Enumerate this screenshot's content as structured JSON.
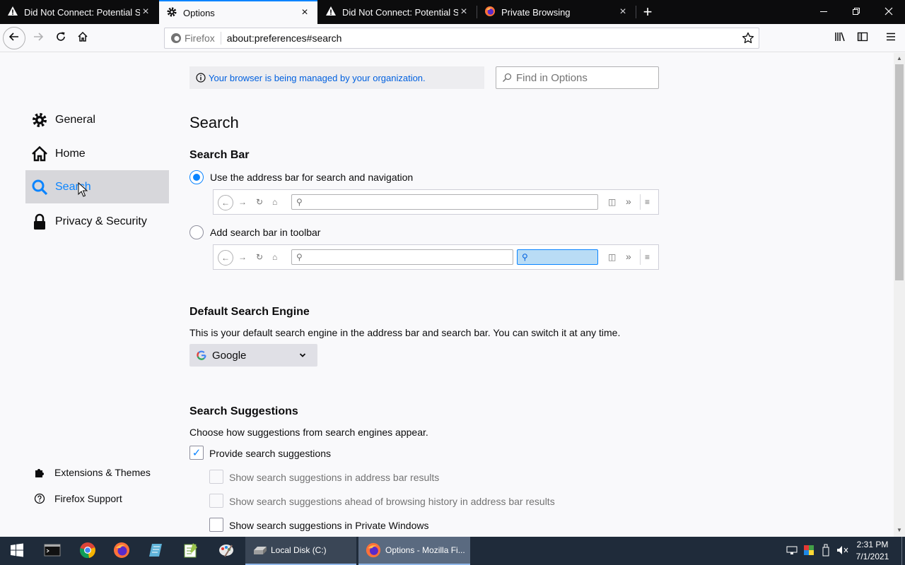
{
  "tabs": [
    {
      "label": "Did Not Connect: Potential Sec",
      "icon": "warning-icon"
    },
    {
      "label": "Options",
      "icon": "gear-icon"
    },
    {
      "label": "Did Not Connect: Potential Sec",
      "icon": "warning-icon"
    },
    {
      "label": "Private Browsing",
      "icon": "firefox-icon"
    }
  ],
  "urlbar": {
    "identity": "Firefox",
    "url": "about:preferences#search"
  },
  "managed_notice": "Your browser is being managed by your organization.",
  "find_placeholder": "Find in Options",
  "sidebar": {
    "items": [
      {
        "label": "General",
        "icon": "gear-icon"
      },
      {
        "label": "Home",
        "icon": "home-icon"
      },
      {
        "label": "Search",
        "icon": "search-icon"
      },
      {
        "label": "Privacy & Security",
        "icon": "lock-icon"
      }
    ],
    "footer": [
      {
        "label": "Extensions & Themes",
        "icon": "puzzle-icon"
      },
      {
        "label": "Firefox Support",
        "icon": "help-icon"
      }
    ]
  },
  "page": {
    "title": "Search",
    "search_bar": {
      "heading": "Search Bar",
      "option1": "Use the address bar for search and navigation",
      "option2": "Add search bar in toolbar"
    },
    "default_engine": {
      "heading": "Default Search Engine",
      "description": "This is your default search engine in the address bar and search bar. You can switch it at any time.",
      "selected": "Google"
    },
    "suggestions": {
      "heading": "Search Suggestions",
      "description": "Choose how suggestions from search engines appear.",
      "items": [
        {
          "label": "Provide search suggestions",
          "checked": true
        },
        {
          "label": "Show search suggestions in address bar results",
          "checked": false,
          "disabled": true
        },
        {
          "label": "Show search suggestions ahead of browsing history in address bar results",
          "checked": false,
          "disabled": true
        },
        {
          "label": "Show search suggestions in Private Windows",
          "checked": false
        }
      ]
    }
  },
  "taskbar": {
    "items": [
      {
        "label": "Local Disk (C:)"
      },
      {
        "label": "Options - Mozilla Fi..."
      }
    ],
    "time": "2:31 PM",
    "date": "7/1/2021"
  },
  "colors": {
    "accent": "#0a84ff",
    "tabbar": "#0c0c0d",
    "taskbar": "#1f2b3a"
  }
}
